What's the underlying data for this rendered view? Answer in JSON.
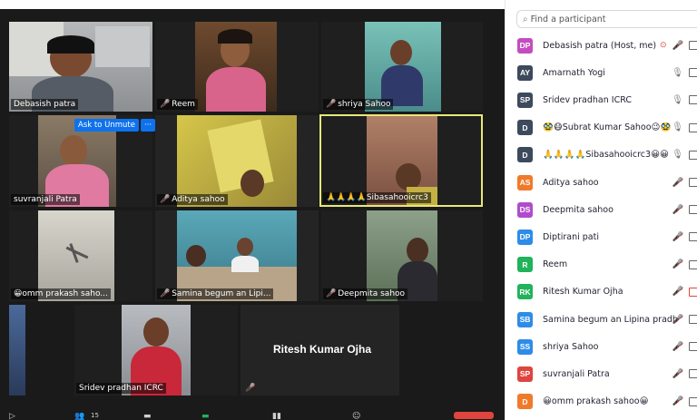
{
  "video": {
    "tiles": [
      {
        "name": "Debasish patra",
        "muted": false
      },
      {
        "name": "Reem",
        "muted": true
      },
      {
        "name": "shriya Sahoo",
        "muted": true
      },
      {
        "name": "suvranjali Patra",
        "muted": false
      },
      {
        "name": "Aditya sahoo",
        "muted": true
      },
      {
        "name": "🙏🙏🙏🙏Sibasahooicrc3",
        "muted": false
      },
      {
        "name": "😀omm prakash saho...",
        "muted": false
      },
      {
        "name": "Samina begum an Lipi...",
        "muted": true
      },
      {
        "name": "Deepmita sahoo",
        "muted": true
      },
      {
        "name": "Sridev pradhan ICRC",
        "muted": false
      },
      {
        "name": "Ritesh Kumar Ojha",
        "muted": true
      }
    ],
    "unmute_button": "Ask to Unmute",
    "more_button": "···",
    "toolbar_count": "15"
  },
  "panel": {
    "search_placeholder": "Find a participant",
    "participants": [
      {
        "initials": "DP",
        "color": "#c34cc0",
        "name": "Debasish patra (Host, me)",
        "mic": "share",
        "video": "on"
      },
      {
        "initials": "AY",
        "color": "#3d4a5c",
        "name": "Amarnath Yogi",
        "mic": "on",
        "video": "on"
      },
      {
        "initials": "SP",
        "color": "#3d4a5c",
        "name": "Sridev pradhan ICRC",
        "mic": "on",
        "video": "on"
      },
      {
        "initials": "D",
        "color": "#3d4a5c",
        "name": "🥸😷Subrat Kumar Sahoo😉🥸",
        "mic": "on",
        "video": "on"
      },
      {
        "initials": "D",
        "color": "#3d4a5c",
        "name": "🙏🙏🙏🙏Sibasahooicrc3😀😀",
        "mic": "on",
        "video": "on"
      },
      {
        "initials": "AS",
        "color": "#f07a2b",
        "name": "Aditya sahoo",
        "mic": "muted",
        "video": "on"
      },
      {
        "initials": "DS",
        "color": "#b04ccc",
        "name": "Deepmita sahoo",
        "mic": "muted",
        "video": "on"
      },
      {
        "initials": "DP",
        "color": "#2d8ce8",
        "name": "Diptirani pati",
        "mic": "muted",
        "video": "on"
      },
      {
        "initials": "R",
        "color": "#22b25a",
        "name": "Reem",
        "mic": "muted",
        "video": "on"
      },
      {
        "initials": "RK",
        "color": "#22b25a",
        "name": "Ritesh Kumar Ojha",
        "mic": "muted",
        "video": "off"
      },
      {
        "initials": "SB",
        "color": "#2d8ce8",
        "name": "Samina begum an Lipina pradh...",
        "mic": "muted",
        "video": "on"
      },
      {
        "initials": "SS",
        "color": "#2d8ce8",
        "name": "shriya Sahoo",
        "mic": "muted",
        "video": "on"
      },
      {
        "initials": "SP",
        "color": "#e0443e",
        "name": "suvranjali Patra",
        "mic": "muted",
        "video": "on"
      },
      {
        "initials": "D",
        "color": "#f07a2b",
        "name": "😀omm prakash sahoo😀",
        "mic": "muted",
        "video": "on"
      }
    ]
  },
  "colors": {
    "zoom_blue": "#0e72ed",
    "mute_red": "#e0443e",
    "speaker_yellow": "#e8e87a"
  }
}
